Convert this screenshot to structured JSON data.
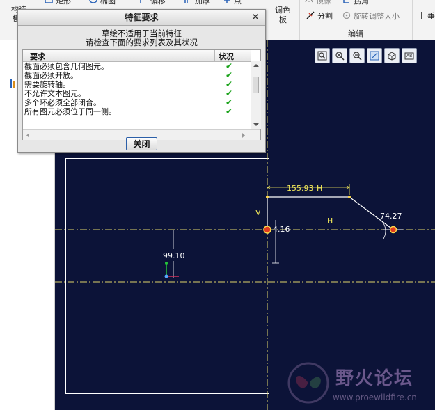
{
  "ribbon": {
    "group_structure_label": "构造",
    "group_structure_sub": "模",
    "btn_rectangle": "矩形",
    "btn_ellipse": "椭圆",
    "btn_offset": "偏移",
    "btn_thicken": "加厚",
    "btn_point": "点",
    "btn_palette_line1": "调色",
    "btn_palette_line2": "板",
    "btn_mirror": "镜像",
    "btn_corner": "拐角",
    "btn_divide": "分割",
    "btn_rotate_resize": "旋转调整大小",
    "group_edit": "编辑",
    "btn_vertical": "垂"
  },
  "dialog": {
    "title": "特征要求",
    "close_glyph": "✕",
    "message_line1": "草绘不适用于当前特征",
    "message_line2": "请检查下面的要求列表及其状况",
    "col_requirement": "要求",
    "col_status": "状况",
    "rows": [
      {
        "text": "截面必须包含几何图元。",
        "status": "✔"
      },
      {
        "text": "截面必须开放。",
        "status": "✔"
      },
      {
        "text": "需要旋转轴。",
        "status": "✔"
      },
      {
        "text": "不允许文本图元。",
        "status": "✔"
      },
      {
        "text": "多个环必须全部闭合。",
        "status": "✔"
      },
      {
        "text": "所有图元必须位于同一侧。",
        "status": "✔"
      }
    ],
    "close_button": "关闭"
  },
  "sketch": {
    "dim_top": "155.93",
    "label_h_top": "H",
    "label_v": "V",
    "dim_small": "4.16",
    "label_h_mid": "H",
    "dim_angle": "74.27",
    "dim_left": "99.10"
  },
  "watermark": {
    "title": "野火论坛",
    "url": "www.proewildfire.cn"
  },
  "colors": {
    "canvas_bg": "#0c1338",
    "sketch_line": "#ffffff",
    "dimension": "#f2e85a",
    "centerline": "#e0d56a"
  }
}
